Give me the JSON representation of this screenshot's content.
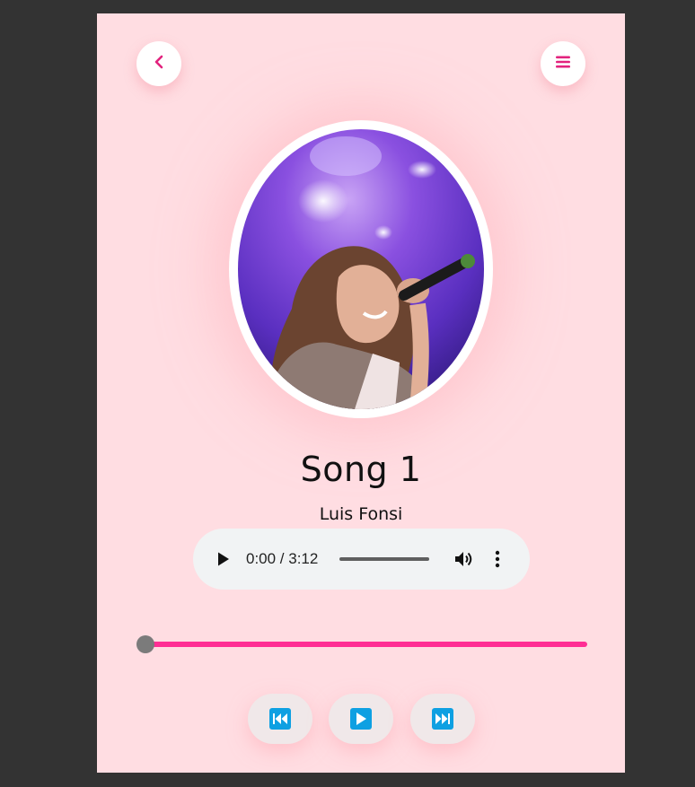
{
  "nav": {
    "back_icon": "chevron-left-icon",
    "menu_icon": "hamburger-menu-icon"
  },
  "track": {
    "title": "Song 1",
    "artist": "Luis Fonsi"
  },
  "audio_player": {
    "time": "0:00 / 3:12",
    "progress": 0
  },
  "seek": {
    "progress": 0
  },
  "controls": {
    "prev_icon": "skip-previous-icon",
    "play_icon": "play-icon",
    "next_icon": "skip-next-icon"
  },
  "colors": {
    "background": "#ffdde2",
    "accent": "#ff2e94",
    "icon_accent": "#e2237e",
    "control_icon": "#0ea0e2"
  }
}
